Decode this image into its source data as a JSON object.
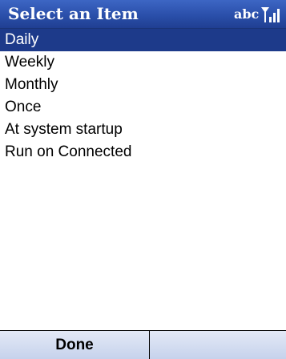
{
  "titlebar": {
    "title": "Select an Item",
    "input_mode": "abc",
    "signal_icon": "signal-strength-icon"
  },
  "list": {
    "items": [
      {
        "label": "Daily",
        "selected": true
      },
      {
        "label": "Weekly",
        "selected": false
      },
      {
        "label": "Monthly",
        "selected": false
      },
      {
        "label": "Once",
        "selected": false
      },
      {
        "label": "At system startup",
        "selected": false
      },
      {
        "label": "Run on Connected",
        "selected": false
      }
    ]
  },
  "softkeys": {
    "left": "Done",
    "right": ""
  },
  "colors": {
    "titlebar": "#2a4faa",
    "selection": "#1d3a8a",
    "softkey_bar": "#cfd9ef"
  }
}
